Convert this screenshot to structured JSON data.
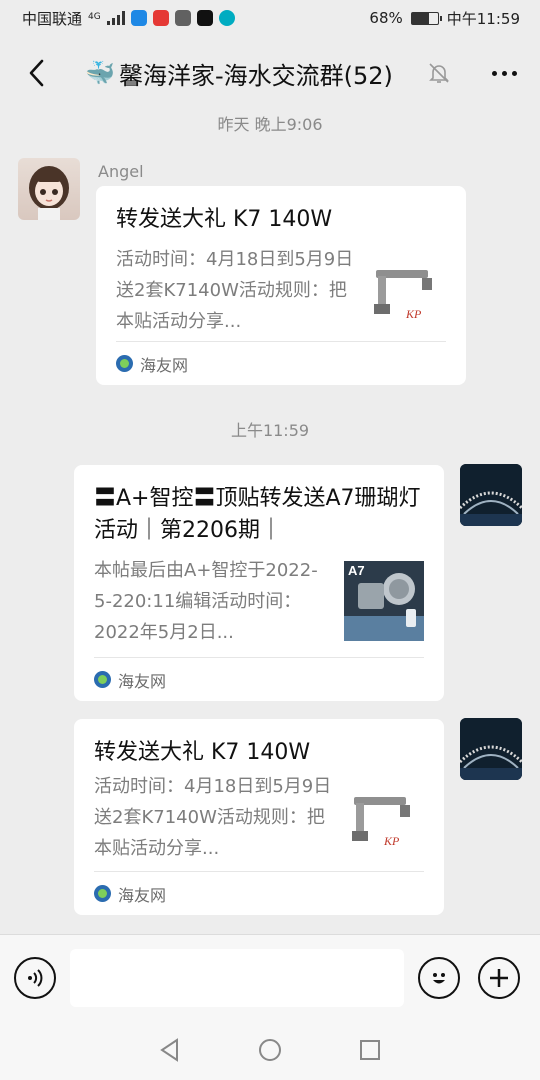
{
  "status_bar": {
    "carrier": "中国联通",
    "network": "4G",
    "battery_percent": "68%",
    "battery_level": 0.68,
    "time": "中午11:59",
    "app_icon_colors": [
      "#1e88e5",
      "#e53935",
      "#616161",
      "#111111",
      "#00acc1"
    ]
  },
  "header": {
    "title_emoji": "🐳",
    "title": "馨海洋家-海水交流群(52)"
  },
  "timestamps": {
    "first": "昨天 晚上9:06",
    "second": "上午11:59"
  },
  "messages": [
    {
      "sender": "Angel",
      "card_title": "转发送大礼 K7 140W",
      "card_desc": "活动时间：4月18日到5月9日送2套K7140W活动规则：把本贴活动分享...",
      "source": "海友网"
    },
    {
      "card_title": "〓A+智控〓顶贴转发送A7珊瑚灯活动｜第2206期｜",
      "card_desc": "本帖最后由A+智控于2022-5-220:11编辑活动时间：2022年5月2日...",
      "thumb_label": "A7",
      "source": "海友网"
    },
    {
      "card_title": "转发送大礼 K7 140W",
      "card_desc": "活动时间：4月18日到5月9日送2套K7140W活动规则：把本贴活动分享...",
      "source": "海友网"
    }
  ],
  "colors": {
    "background": "#ededed",
    "card": "#ffffff",
    "secondary_text": "#8a8a8a"
  }
}
